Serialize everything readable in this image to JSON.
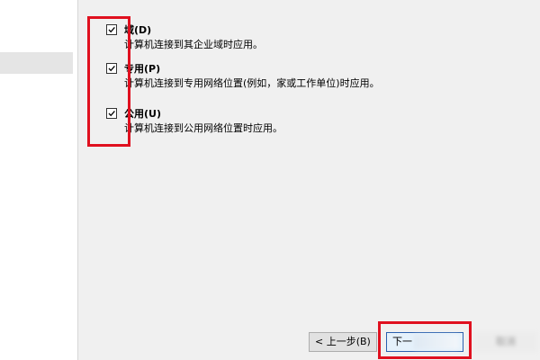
{
  "options": [
    {
      "title": "域(D)",
      "desc": "计算机连接到其企业域时应用。",
      "checked": true
    },
    {
      "title": "专用(P)",
      "desc": "计算机连接到专用网络位置(例如，家或工作单位)时应用。",
      "checked": true
    },
    {
      "title": "公用(U)",
      "desc": "计算机连接到公用网络位置时应用。",
      "checked": true
    }
  ],
  "buttons": {
    "back_label": "< 上一步(B)",
    "next_label": "下一",
    "cancel_label": "取消"
  },
  "colors": {
    "highlight": "#e0101f",
    "background": "#f0f0f0"
  }
}
